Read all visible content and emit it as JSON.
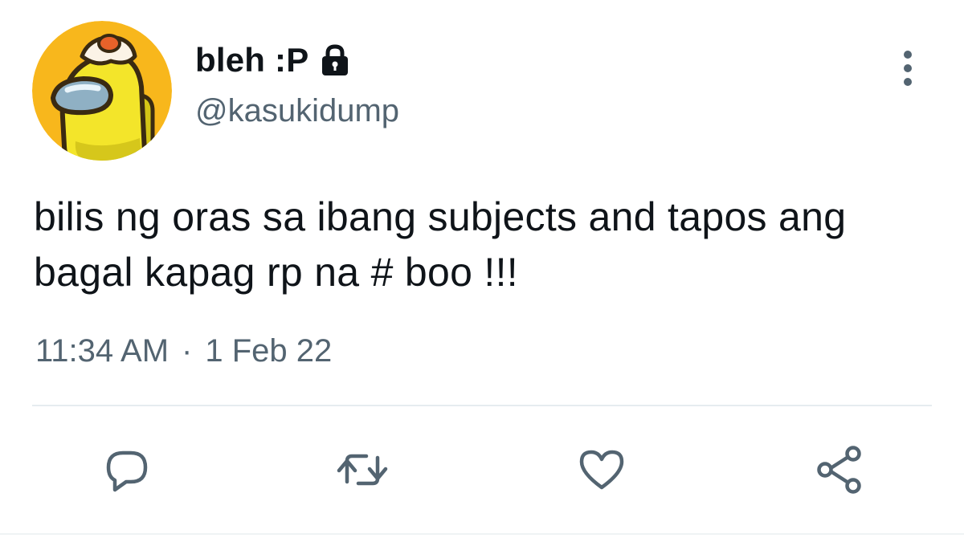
{
  "user": {
    "display_name": "bleh :P",
    "handle": "@kasukidump",
    "protected": true
  },
  "tweet": {
    "text_lines": [
      "bilis ng oras sa ibang subjects and tapos ang",
      "bagal kapag rp na # boo !!!"
    ],
    "time": "11:34 AM",
    "separator": "·",
    "date": "1 Feb 22"
  },
  "icons": {
    "avatar": "among-us-crewmate-avatar",
    "lock": "lock-icon",
    "more": "more-vertical-icon",
    "reply": "reply-icon",
    "retweet": "retweet-icon",
    "like": "like-icon",
    "share": "share-icon"
  },
  "colors": {
    "text_primary": "#0f1419",
    "text_secondary": "#536471",
    "icon": "#536471",
    "avatar_bg": "#f8b71c",
    "crewmate": "#f3e52a"
  }
}
